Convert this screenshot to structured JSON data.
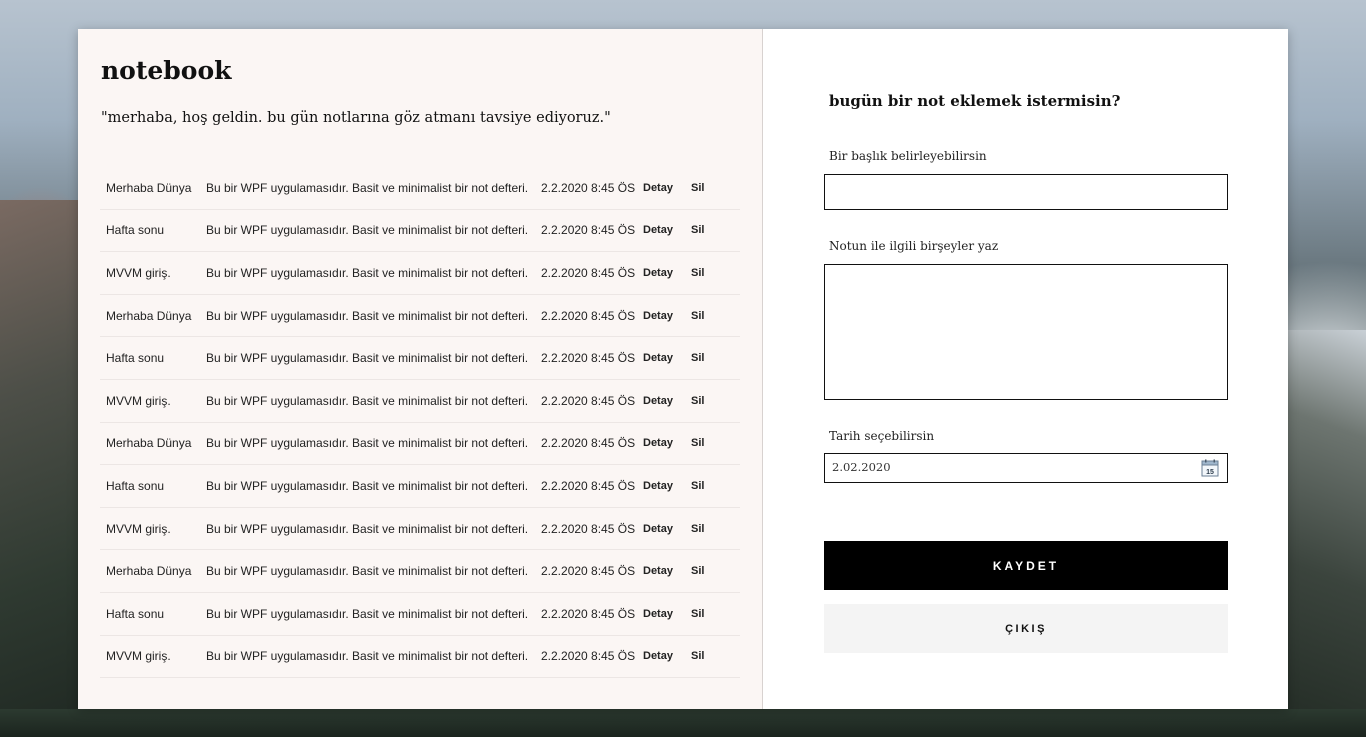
{
  "app": {
    "title": "notebook",
    "welcome": "\"merhaba, hoş geldin. bu gün notlarına göz atmanı tavsiye ediyoruz.\""
  },
  "notes": [
    {
      "title": "Merhaba Dünya",
      "body": "Bu bir WPF uygulamasıdır. Basit ve minimalist bir not defteri.",
      "date": "2.2.2020 8:45 ÖS",
      "detail_label": "Detay",
      "delete_label": "Sil"
    },
    {
      "title": "Hafta sonu",
      "body": "Bu bir WPF uygulamasıdır. Basit ve minimalist bir not defteri.",
      "date": "2.2.2020 8:45 ÖS",
      "detail_label": "Detay",
      "delete_label": "Sil"
    },
    {
      "title": "MVVM giriş.",
      "body": "Bu bir WPF uygulamasıdır. Basit ve minimalist bir not defteri.",
      "date": "2.2.2020 8:45 ÖS",
      "detail_label": "Detay",
      "delete_label": "Sil"
    },
    {
      "title": "Merhaba Dünya",
      "body": "Bu bir WPF uygulamasıdır. Basit ve minimalist bir not defteri.",
      "date": "2.2.2020 8:45 ÖS",
      "detail_label": "Detay",
      "delete_label": "Sil"
    },
    {
      "title": "Hafta sonu",
      "body": "Bu bir WPF uygulamasıdır. Basit ve minimalist bir not defteri.",
      "date": "2.2.2020 8:45 ÖS",
      "detail_label": "Detay",
      "delete_label": "Sil"
    },
    {
      "title": "MVVM giriş.",
      "body": "Bu bir WPF uygulamasıdır. Basit ve minimalist bir not defteri.",
      "date": "2.2.2020 8:45 ÖS",
      "detail_label": "Detay",
      "delete_label": "Sil"
    },
    {
      "title": "Merhaba Dünya",
      "body": "Bu bir WPF uygulamasıdır. Basit ve minimalist bir not defteri.",
      "date": "2.2.2020 8:45 ÖS",
      "detail_label": "Detay",
      "delete_label": "Sil"
    },
    {
      "title": "Hafta sonu",
      "body": "Bu bir WPF uygulamasıdır. Basit ve minimalist bir not defteri.",
      "date": "2.2.2020 8:45 ÖS",
      "detail_label": "Detay",
      "delete_label": "Sil"
    },
    {
      "title": "MVVM giriş.",
      "body": "Bu bir WPF uygulamasıdır. Basit ve minimalist bir not defteri.",
      "date": "2.2.2020 8:45 ÖS",
      "detail_label": "Detay",
      "delete_label": "Sil"
    },
    {
      "title": "Merhaba Dünya",
      "body": "Bu bir WPF uygulamasıdır. Basit ve minimalist bir not defteri.",
      "date": "2.2.2020 8:45 ÖS",
      "detail_label": "Detay",
      "delete_label": "Sil"
    },
    {
      "title": "Hafta sonu",
      "body": "Bu bir WPF uygulamasıdır. Basit ve minimalist bir not defteri.",
      "date": "2.2.2020 8:45 ÖS",
      "detail_label": "Detay",
      "delete_label": "Sil"
    },
    {
      "title": "MVVM giriş.",
      "body": "Bu bir WPF uygulamasıdır. Basit ve minimalist bir not defteri.",
      "date": "2.2.2020 8:45 ÖS",
      "detail_label": "Detay",
      "delete_label": "Sil"
    }
  ],
  "form": {
    "heading": "bugün bir not eklemek istermisin?",
    "title_label": "Bir başlık belirleyebilirsin",
    "title_value": "",
    "body_label": "Notun ile ilgili birşeyler yaz",
    "body_value": "",
    "date_label": "Tarih seçebilirsin",
    "date_value": "2.02.2020",
    "calendar_icon": "calendar-icon",
    "calendar_day": "15",
    "save_label": "KAYDET",
    "exit_label": "ÇIKIŞ"
  },
  "colors": {
    "left_panel_bg": "#fbf6f4",
    "right_panel_bg": "#ffffff",
    "save_button_bg": "#000000",
    "exit_button_bg": "#f4f4f4"
  }
}
